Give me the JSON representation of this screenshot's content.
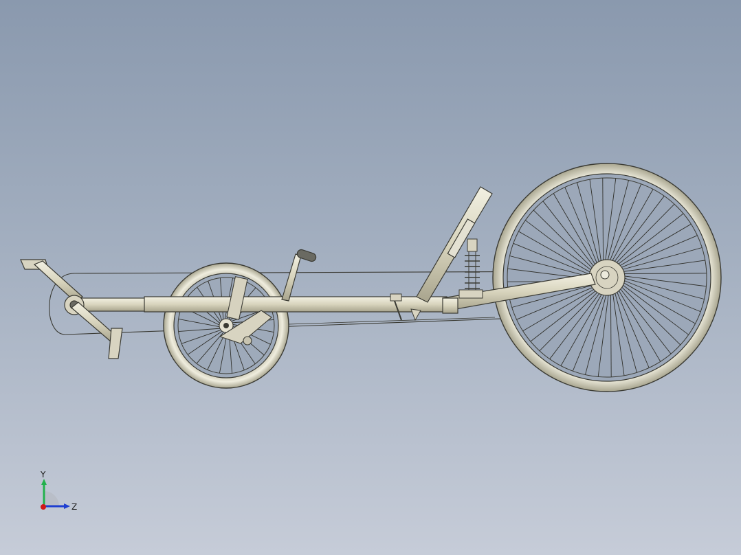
{
  "viewport": {
    "background_top": "#8a99ae",
    "background_bottom": "#c6ccd8",
    "model_color": "#dcd8c4",
    "edge_color": "#3a3a33"
  },
  "model": {
    "name": "recumbent-tricycle",
    "parts": [
      "front-wheel",
      "rear-wheel",
      "main-frame",
      "crankset",
      "seat-stay",
      "rear-shock",
      "handlebar",
      "chain",
      "pedals"
    ]
  },
  "triad": {
    "y_label": "Y",
    "z_label": "Z",
    "y_color": "#22b14c",
    "z_color": "#1f3fd1",
    "x_color": "#d01818"
  }
}
